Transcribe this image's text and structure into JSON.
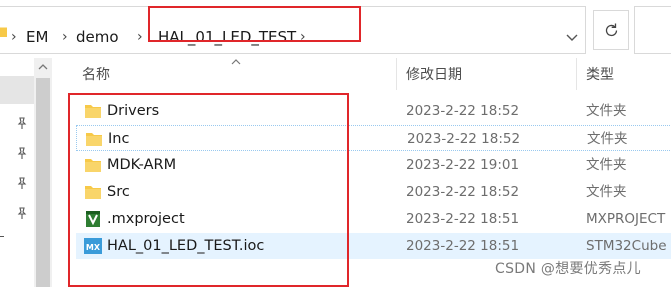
{
  "address_bar": {
    "breadcrumbs": [
      "EM",
      "demo",
      "HAL_01_LED_TEST"
    ]
  },
  "columns": {
    "name": "名称",
    "modified": "修改日期",
    "type": "类型"
  },
  "files": [
    {
      "name": "Drivers",
      "modified": "2023-2-22 18:52",
      "type": "文件夹",
      "icon": "folder-icon"
    },
    {
      "name": "Inc",
      "modified": "2023-2-22 18:52",
      "type": "文件夹",
      "icon": "folder-icon"
    },
    {
      "name": "MDK-ARM",
      "modified": "2023-2-22 19:01",
      "type": "文件夹",
      "icon": "folder-icon"
    },
    {
      "name": "Src",
      "modified": "2023-2-22 18:52",
      "type": "文件夹",
      "icon": "folder-icon"
    },
    {
      "name": ".mxproject",
      "modified": "2023-2-22 18:51",
      "type": "MXPROJECT",
      "icon": "mxproject-file-icon"
    },
    {
      "name": "HAL_01_LED_TEST.ioc",
      "modified": "2023-2-22 18:51",
      "type": "STM32Cube",
      "icon": "stm32cubemx-ioc-icon"
    }
  ],
  "watermark": "CSDN @想要优秀点儿",
  "colors": {
    "annotation_red": "#e0262a",
    "folder_yellow": "#f7c948",
    "selection_blue": "#e5f3ff"
  }
}
